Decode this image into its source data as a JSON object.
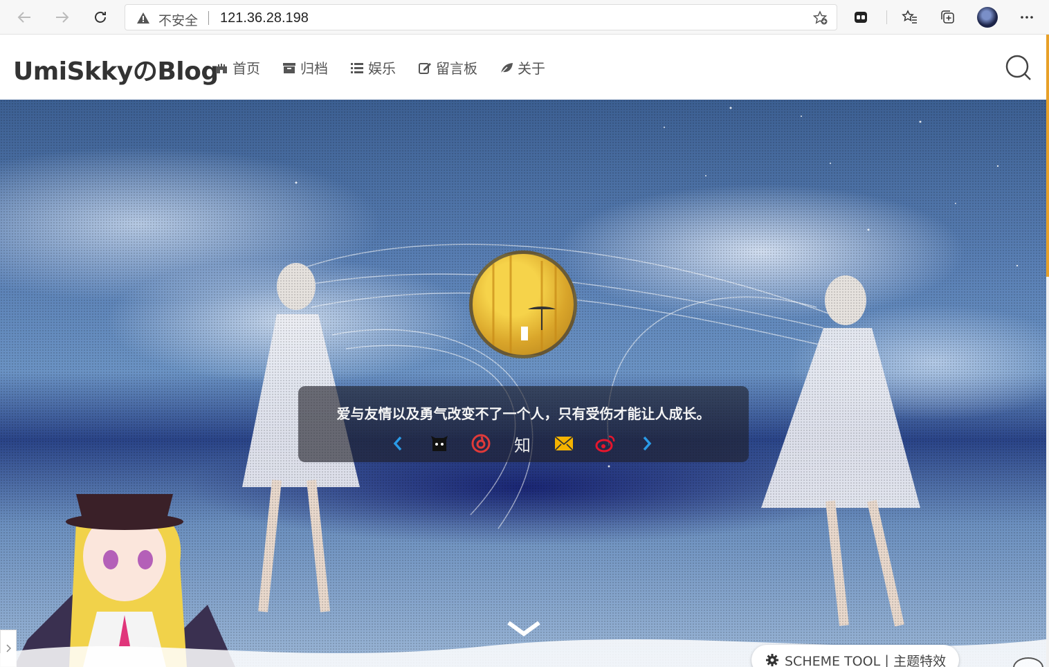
{
  "browser": {
    "insecure_label": "不安全",
    "url": "121.36.28.198"
  },
  "header": {
    "logo": "UmiSkkyのBlog",
    "nav": [
      {
        "label": "首页",
        "icon": "castle-icon"
      },
      {
        "label": "归档",
        "icon": "archive-icon"
      },
      {
        "label": "娱乐",
        "icon": "list-icon"
      },
      {
        "label": "留言板",
        "icon": "edit-icon"
      },
      {
        "label": "关于",
        "icon": "leaf-icon"
      }
    ]
  },
  "hero": {
    "quote": "爱与友情以及勇气改变不了一个人，只有受伤才能让人成长。",
    "social": [
      {
        "name": "prev-arrow-icon",
        "color": "#2a9be8"
      },
      {
        "name": "github-icon",
        "color": "#111111"
      },
      {
        "name": "netease-music-icon",
        "color": "#e03a3a"
      },
      {
        "name": "zhihu-icon",
        "label": "知",
        "color": "#e8e8e8"
      },
      {
        "name": "mail-icon",
        "color": "#f5b300"
      },
      {
        "name": "weibo-icon",
        "color": "#e6162d"
      },
      {
        "name": "next-arrow-icon",
        "color": "#2a9be8"
      }
    ]
  },
  "scheme_tool": {
    "label": "SCHEME TOOL丨主题特效"
  },
  "colors": {
    "accent": "#e8a028"
  }
}
